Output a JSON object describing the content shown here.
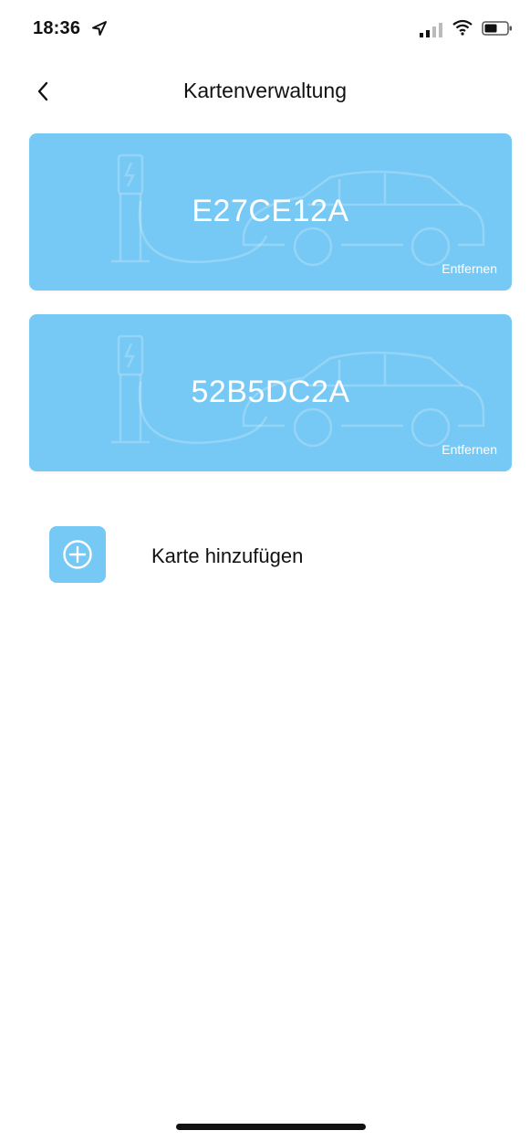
{
  "status_bar": {
    "time": "18:36",
    "icons": [
      "location-arrow-icon",
      "signal-icon",
      "wifi-icon",
      "battery-icon"
    ]
  },
  "nav": {
    "title": "Kartenverwaltung",
    "back_icon": "chevron-left-icon"
  },
  "cards": [
    {
      "number": "E27CE12A",
      "remove_label": "Entfernen"
    },
    {
      "number": "52B5DC2A",
      "remove_label": "Entfernen"
    }
  ],
  "add_card": {
    "label": "Karte hinzufügen",
    "icon": "plus-circle-icon"
  },
  "colors": {
    "card_background": "#77c9f5",
    "text_primary": "#111111",
    "card_text": "#ffffff"
  }
}
